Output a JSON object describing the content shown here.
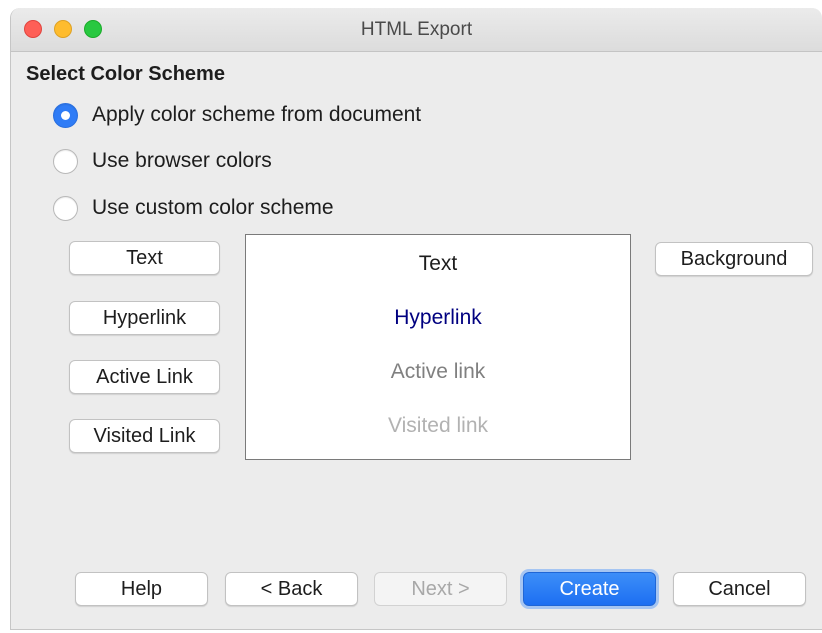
{
  "window": {
    "title": "HTML Export"
  },
  "section": {
    "title": "Select Color Scheme"
  },
  "options": [
    {
      "label": "Apply color scheme from document",
      "checked": true
    },
    {
      "label": "Use browser colors",
      "checked": false
    },
    {
      "label": "Use custom color scheme",
      "checked": false
    }
  ],
  "color_buttons": {
    "text": "Text",
    "hyperlink": "Hyperlink",
    "active_link": "Active Link",
    "visited_link": "Visited Link",
    "background": "Background"
  },
  "preview": {
    "text": "Text",
    "hyperlink": "Hyperlink",
    "active_link": "Active link",
    "visited_link": "Visited link",
    "colors": {
      "text": "#1d1d1d",
      "hyperlink": "#000080",
      "active_link": "#808080",
      "visited_link": "#b2b2b2"
    }
  },
  "footer": {
    "help": "Help",
    "back": "< Back",
    "next": "Next >",
    "create": "Create",
    "cancel": "Cancel"
  },
  "colors": {
    "accent": "#2f7cf6",
    "window_bg": "#ececec"
  }
}
